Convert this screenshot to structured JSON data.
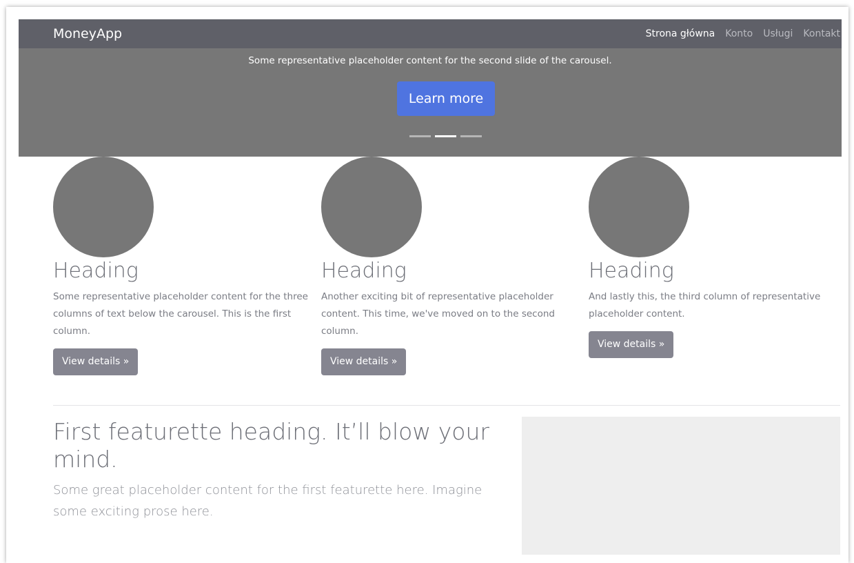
{
  "navbar": {
    "brand": "MoneyApp",
    "links": [
      "Strona główna",
      "Konto",
      "Usługi",
      "Kontakt"
    ]
  },
  "carousel": {
    "caption": "Some representative placeholder content for the second slide of the carousel.",
    "button": "Learn more",
    "active_slide": 2,
    "slide_count": 3
  },
  "columns": [
    {
      "heading": "Heading",
      "text": "Some representative placeholder content for the three columns of text below the carousel. This is the first column.",
      "button": "View details »"
    },
    {
      "heading": "Heading",
      "text": "Another exciting bit of representative placeholder content. This time, we've moved on to the second column.",
      "button": "View details »"
    },
    {
      "heading": "Heading",
      "text": "And lastly this, the third column of representative placeholder content.",
      "button": "View details »"
    }
  ],
  "featurette": {
    "heading": "First featurette heading. It’ll blow your mind.",
    "lead": "Some great placeholder content for the first featurette here. Imagine some exciting prose here."
  },
  "colors": {
    "navbar_bg": "#5f6068",
    "carousel_bg": "#777777",
    "primary_button": "#4f74e0",
    "secondary_button": "#858590",
    "placeholder_image": "#eeeeee"
  }
}
